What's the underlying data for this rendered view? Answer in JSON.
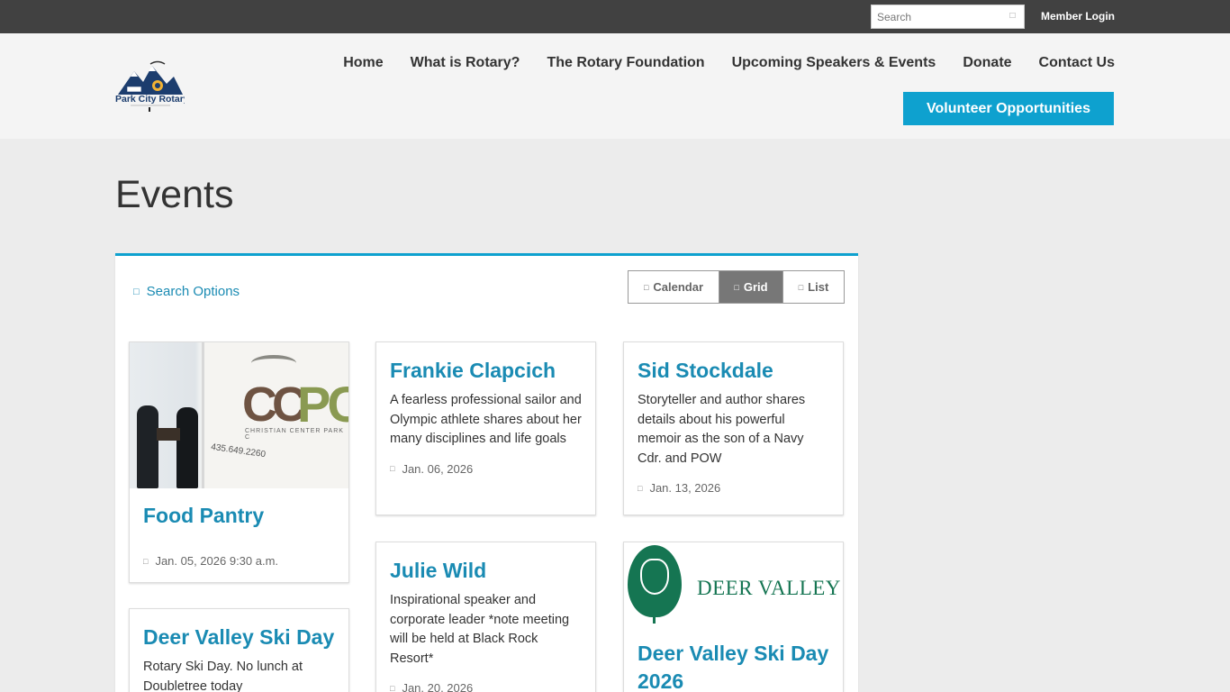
{
  "topbar": {
    "search_placeholder": "Search",
    "member_login": "Member Login"
  },
  "header": {
    "logo_text": "Park City Rotary",
    "nav": [
      {
        "label": "Home"
      },
      {
        "label": "What is Rotary?"
      },
      {
        "label": "The Rotary Foundation"
      },
      {
        "label": "Upcoming Speakers & Events"
      },
      {
        "label": "Donate"
      },
      {
        "label": "Contact Us"
      }
    ],
    "volunteer_label": "Volunteer Opportunities"
  },
  "page": {
    "title": "Events"
  },
  "panel": {
    "search_options": "Search Options",
    "views": {
      "calendar": "Calendar",
      "grid": "Grid",
      "list": "List",
      "active": "grid"
    }
  },
  "events": [
    {
      "title": "Food Pantry",
      "description": "",
      "date": "Jan. 05, 2026 9:30 a.m.",
      "image": "food-pantry-photo"
    },
    {
      "title": "Frankie Clapcich",
      "description": "A fearless professional sailor and Olympic athlete shares about her many disciplines and life goals",
      "date": "Jan. 06, 2026"
    },
    {
      "title": "Sid Stockdale",
      "description": "Storyteller and author shares details about his powerful memoir as the son of a Navy Cdr. and POW",
      "date": "Jan. 13, 2026"
    },
    {
      "title": "Deer Valley Ski Day",
      "description": "Rotary Ski Day. No lunch at Doubletree today",
      "date": ""
    },
    {
      "title": "Julie Wild",
      "description": "Inspirational speaker and corporate leader *note meeting will be held at Black Rock Resort*",
      "date": "Jan. 20, 2026"
    },
    {
      "title": "Deer Valley Ski Day 2026",
      "description": "",
      "date": "",
      "image": "deer-valley-logo",
      "image_text": "DEER VALLEY"
    }
  ],
  "colors": {
    "accent": "#0ea1cf",
    "link": "#1a8bb3",
    "topbar": "#414141"
  }
}
